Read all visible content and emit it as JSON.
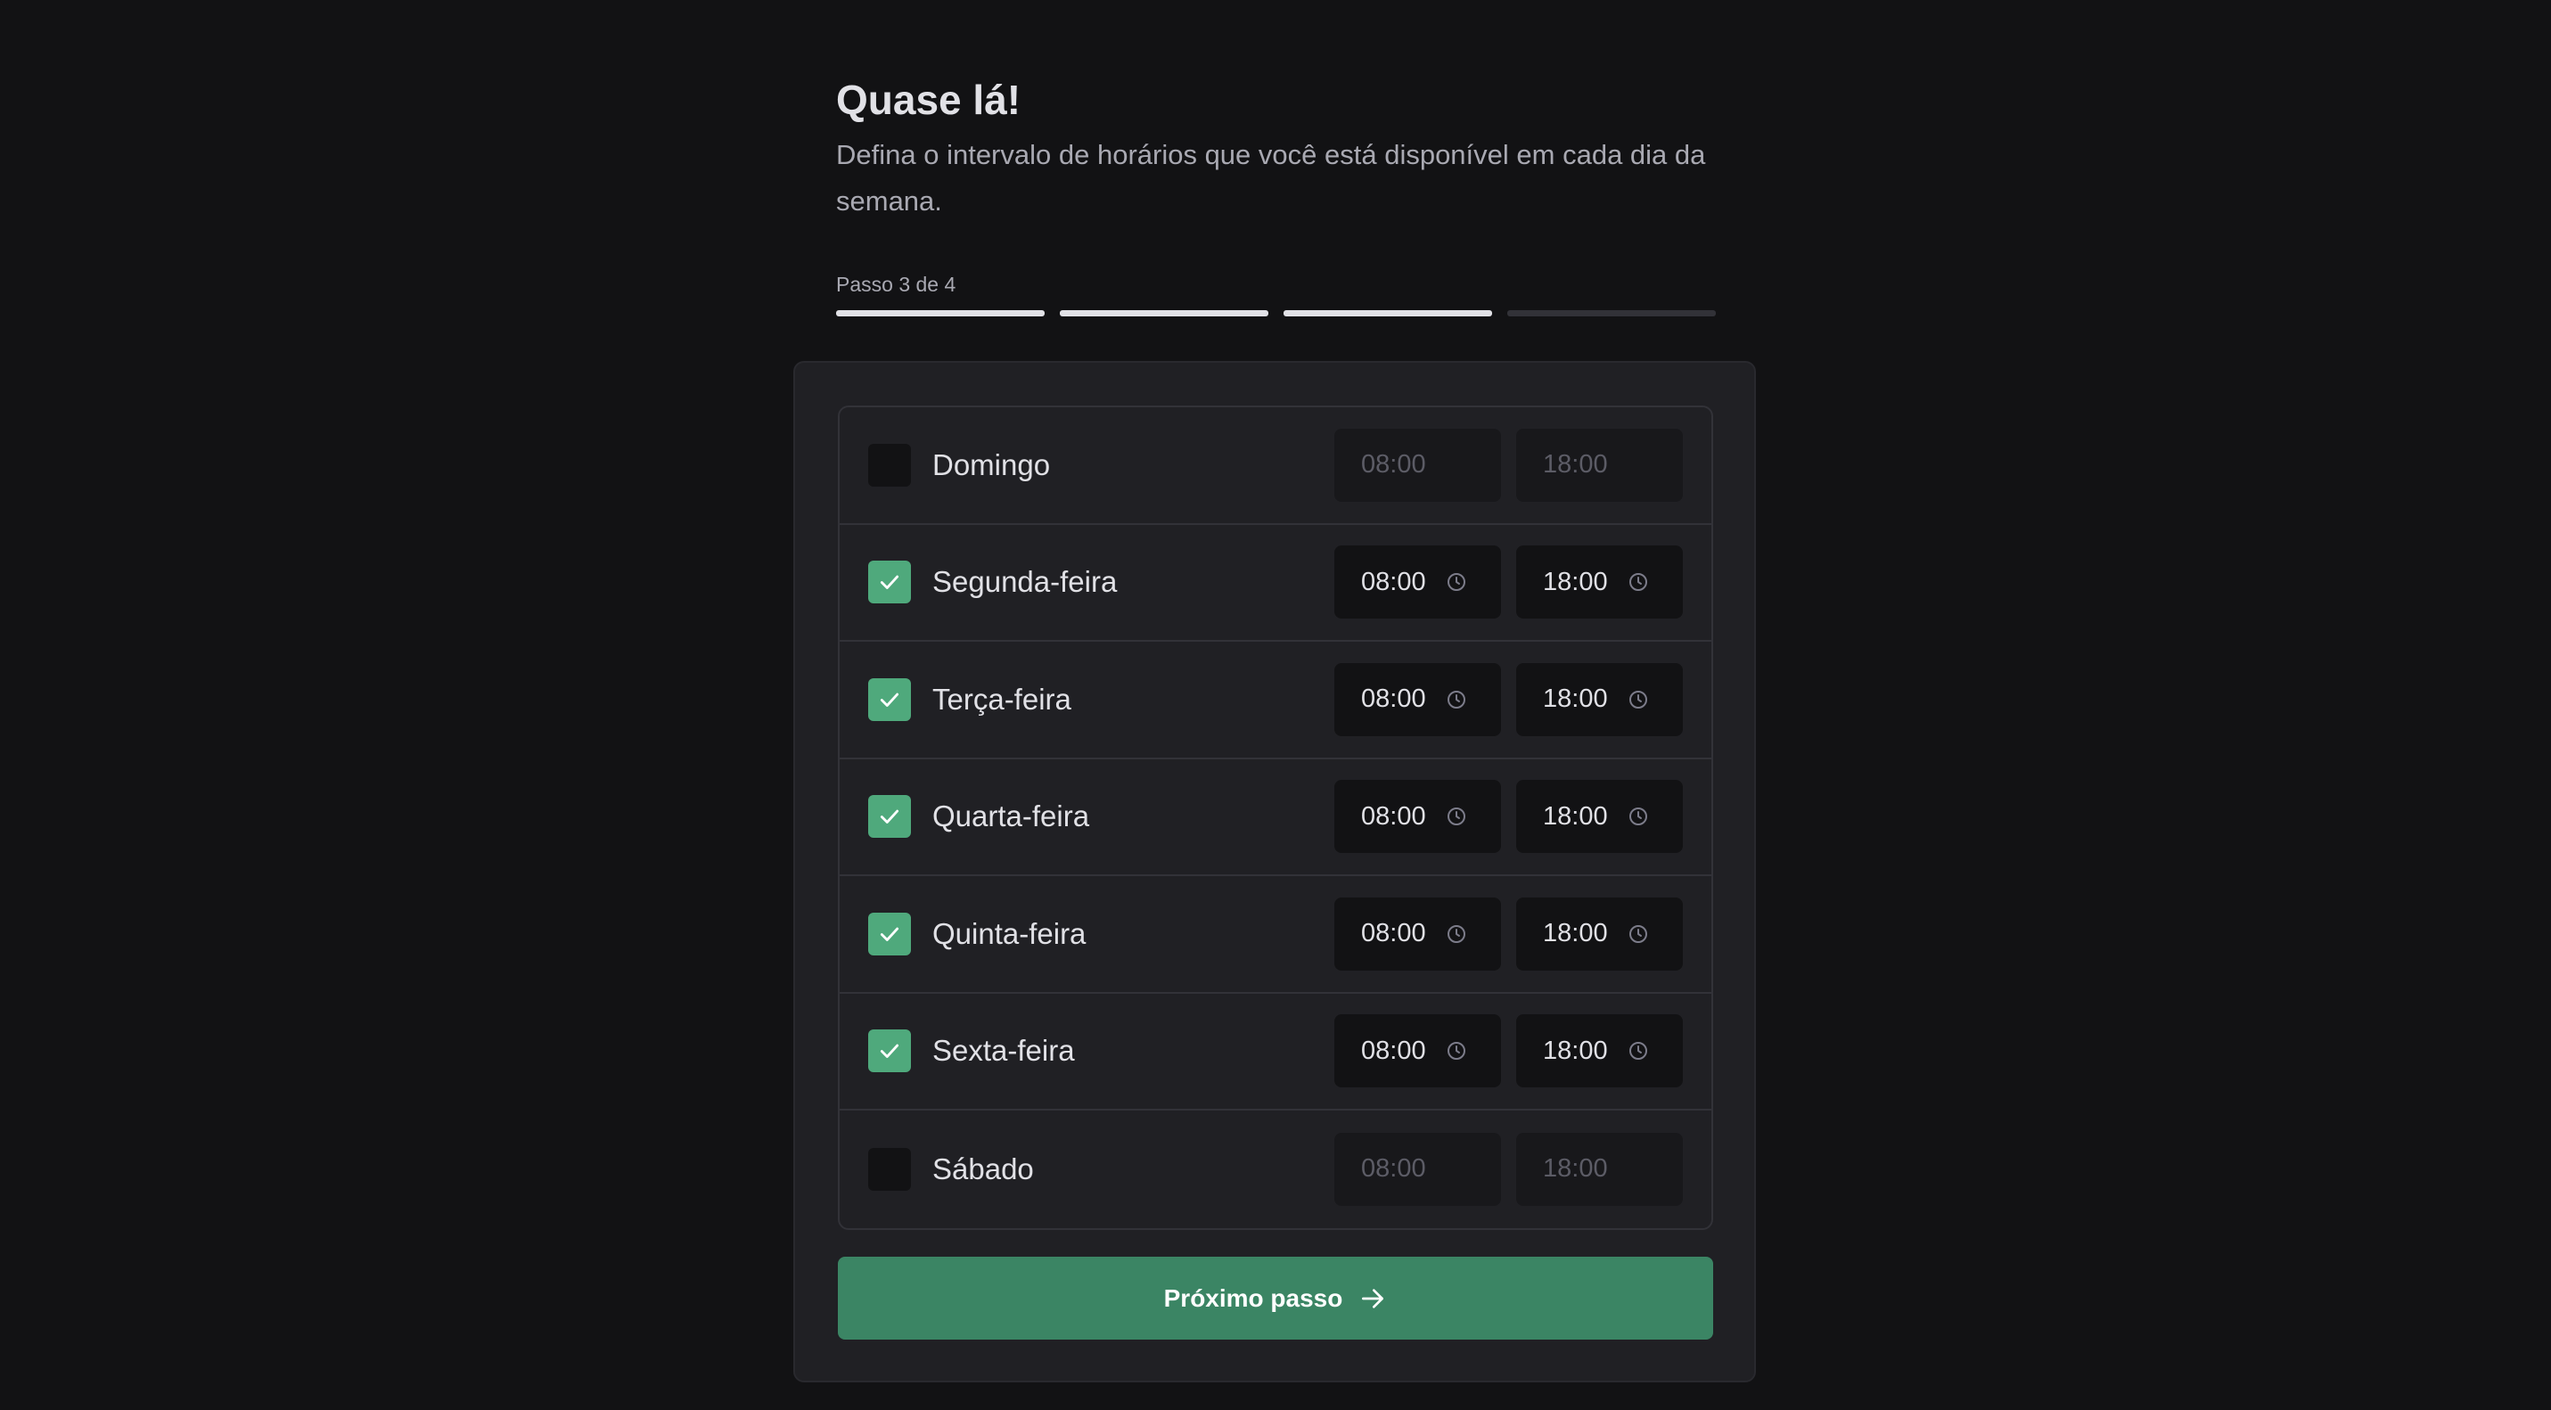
{
  "header": {
    "title": "Quase lá!",
    "subtitle": "Defina o intervalo de horários que você está disponível em cada dia da semana."
  },
  "progress": {
    "label": "Passo 3 de 4",
    "current_step": 3,
    "total_steps": 4
  },
  "days": [
    {
      "label": "Domingo",
      "enabled": false,
      "start": "08:00",
      "end": "18:00"
    },
    {
      "label": "Segunda-feira",
      "enabled": true,
      "start": "08:00",
      "end": "18:00"
    },
    {
      "label": "Terça-feira",
      "enabled": true,
      "start": "08:00",
      "end": "18:00"
    },
    {
      "label": "Quarta-feira",
      "enabled": true,
      "start": "08:00",
      "end": "18:00"
    },
    {
      "label": "Quinta-feira",
      "enabled": true,
      "start": "08:00",
      "end": "18:00"
    },
    {
      "label": "Sexta-feira",
      "enabled": true,
      "start": "08:00",
      "end": "18:00"
    },
    {
      "label": "Sábado",
      "enabled": false,
      "start": "08:00",
      "end": "18:00"
    }
  ],
  "button": {
    "label": "Próximo passo",
    "icon": "arrow-right-icon"
  },
  "colors": {
    "accent": "#3b8564",
    "checkbox_checked": "#4fa97c",
    "background": "#121214",
    "card": "#202024"
  }
}
